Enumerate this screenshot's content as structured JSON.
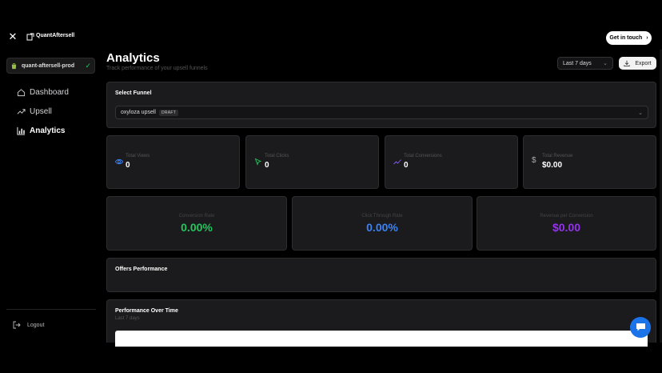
{
  "topbar": {
    "close_icon": "close-icon",
    "app_name": "QuantAftersell",
    "cta_label": "Get in touch"
  },
  "sidebar": {
    "store_name": "quant-aftersell-prod",
    "items": [
      {
        "label": "Dashboard",
        "icon": "home-icon",
        "active": false
      },
      {
        "label": "Upsell",
        "icon": "trend-icon",
        "active": false
      },
      {
        "label": "Analytics",
        "icon": "bar-chart-icon",
        "active": true
      }
    ],
    "logout_label": "Logout"
  },
  "header": {
    "title": "Analytics",
    "subtitle": "Track performance of your upsell funnels",
    "date_range": "Last 7 days",
    "export_label": "Export"
  },
  "funnel": {
    "title": "Select Funnel",
    "selected": "oxyloza upsell",
    "status": "DRAFT"
  },
  "stats": [
    {
      "label": "Total Views",
      "value": "0",
      "icon": "eye-icon",
      "color": "#3b82f6"
    },
    {
      "label": "Total Clicks",
      "value": "0",
      "icon": "cursor-icon",
      "color": "#22c55e"
    },
    {
      "label": "Total Conversions",
      "value": "0",
      "icon": "trend-icon",
      "color": "#8b5cf6"
    },
    {
      "label": "Total Revenue",
      "value": "$0.00",
      "icon": "dollar-icon",
      "color": "#aaaaaa"
    }
  ],
  "rates": [
    {
      "label": "Conversion Rate",
      "value": "0.00%",
      "color": "#22c55e"
    },
    {
      "label": "Click Through Rate",
      "value": "0.00%",
      "color": "#3b82f6"
    },
    {
      "label": "Revenue per Conversion",
      "value": "$0.00",
      "color": "#9333ea"
    }
  ],
  "offers": {
    "title": "Offers Performance"
  },
  "perf": {
    "title": "Performance Over Time",
    "subtitle": "Last 7 days"
  },
  "colors": {
    "accent": "#1a73e8",
    "background": "#000000",
    "card": "#1b1b1d"
  }
}
